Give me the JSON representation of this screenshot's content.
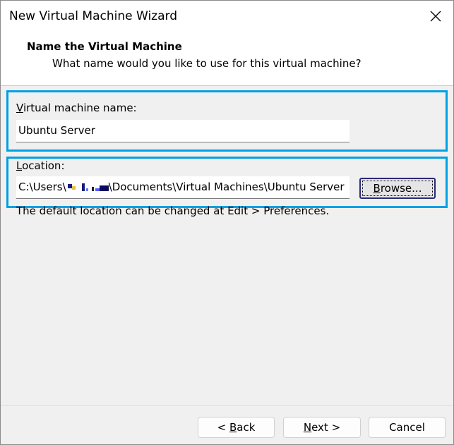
{
  "window": {
    "title": "New Virtual Machine Wizard",
    "close_icon": "close-icon"
  },
  "header": {
    "title": "Name the Virtual Machine",
    "subtitle": "What name would you like to use for this virtual machine?"
  },
  "name_section": {
    "label_accel": "V",
    "label_rest": "irtual machine name:",
    "value": "Ubuntu Server"
  },
  "location_section": {
    "label_accel": "L",
    "label_rest": "ocation:",
    "value_prefix": "C:\\Users\\",
    "value_suffix": "\\Documents\\Virtual Machines\\Ubuntu Server",
    "browse_accel": "B",
    "browse_rest": "rowse...",
    "hint": "The default location can be changed at Edit > Preferences."
  },
  "footer": {
    "back_prefix": "< ",
    "back_accel": "B",
    "back_rest": "ack",
    "next_accel": "N",
    "next_rest": "ext >",
    "cancel_label": "Cancel"
  },
  "colors": {
    "highlight": "#00a0e3",
    "background": "#f0f0f0"
  }
}
